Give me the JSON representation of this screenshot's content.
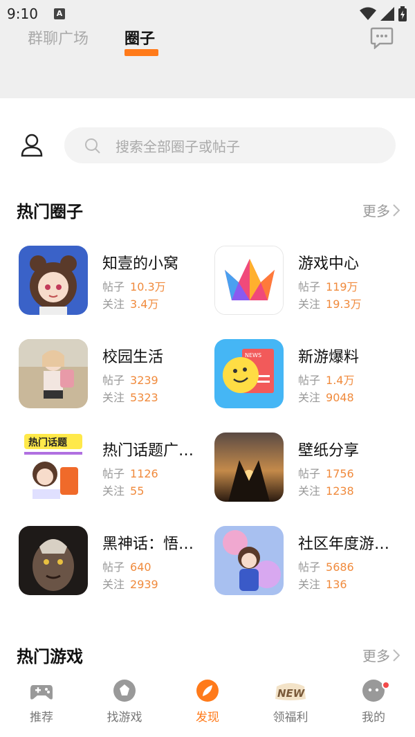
{
  "status": {
    "time": "9:10",
    "a_badge": "A"
  },
  "tabs": {
    "plaza": "群聊广场",
    "circle": "圈子"
  },
  "search": {
    "placeholder": "搜索全部圈子或帖子"
  },
  "hot_circles": {
    "title": "热门圈子",
    "more": "更多",
    "items": [
      {
        "name": "知壹的小窝",
        "posts_label": "帖子",
        "posts": "10.3万",
        "follows_label": "关注",
        "follows": "3.4万",
        "thumb": "anime-girl-avatar"
      },
      {
        "name": "游戏中心",
        "posts_label": "帖子",
        "posts": "119万",
        "follows_label": "关注",
        "follows": "19.3万",
        "thumb": "crown-logo"
      },
      {
        "name": "校园生活",
        "posts_label": "帖子",
        "posts": "3239",
        "follows_label": "关注",
        "follows": "5323",
        "thumb": "schoolgirl-art"
      },
      {
        "name": "新游爆料",
        "posts_label": "帖子",
        "posts": "1.4万",
        "follows_label": "关注",
        "follows": "9048",
        "thumb": "news-smiley",
        "thumb_text": "NEWS"
      },
      {
        "name": "热门话题广…",
        "posts_label": "帖子",
        "posts": "1126",
        "follows_label": "关注",
        "follows": "55",
        "thumb": "hot-topic-banner",
        "thumb_text": "热门话题"
      },
      {
        "name": "壁纸分享",
        "posts_label": "帖子",
        "posts": "1756",
        "follows_label": "关注",
        "follows": "1238",
        "thumb": "sunset-heart-hands"
      },
      {
        "name": "黑神话：悟…",
        "posts_label": "帖子",
        "posts": "640",
        "follows_label": "关注",
        "follows": "2939",
        "thumb": "wukong-face"
      },
      {
        "name": "社区年度游…",
        "posts_label": "帖子",
        "posts": "5686",
        "follows_label": "关注",
        "follows": "136",
        "thumb": "game-heroine-art"
      }
    ]
  },
  "hot_games": {
    "title": "热门游戏",
    "more": "更多"
  },
  "nav": [
    {
      "label": "推荐",
      "icon": "gamepad-icon",
      "active": false
    },
    {
      "label": "找游戏",
      "icon": "explore-icon",
      "active": false
    },
    {
      "label": "发现",
      "icon": "discover-icon",
      "active": true
    },
    {
      "label": "领福利",
      "icon": "new-badge-icon",
      "active": false,
      "badge_text": "NEW"
    },
    {
      "label": "我的",
      "icon": "profile-chat-icon",
      "active": false
    }
  ],
  "colors": {
    "accent": "#ff7a1a",
    "stat_value": "#f08a3c",
    "muted": "#999999"
  }
}
